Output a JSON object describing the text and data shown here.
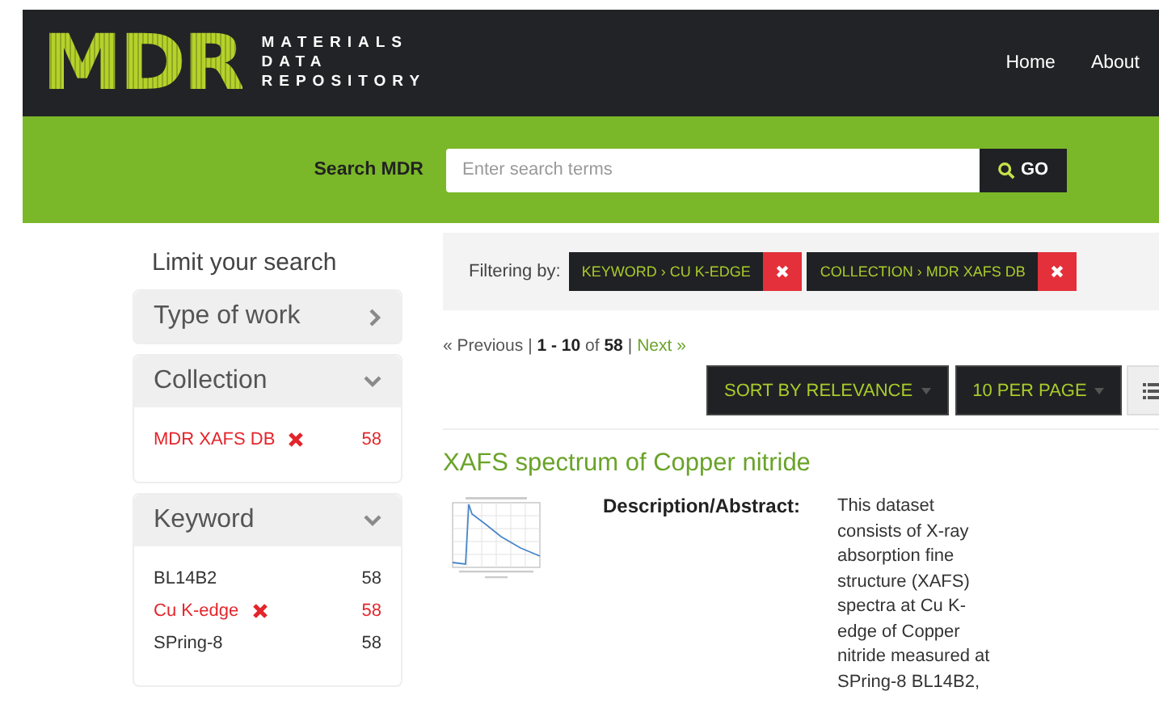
{
  "header": {
    "logo": "MDR",
    "tagline": [
      "MATERIALS",
      "DATA",
      "REPOSITORY"
    ],
    "nav": [
      "Home",
      "About"
    ]
  },
  "search": {
    "label": "Search MDR",
    "placeholder": "Enter search terms",
    "button": "GO"
  },
  "sidebar": {
    "title": "Limit your search",
    "facets": [
      {
        "title": "Type of work",
        "expanded": false
      },
      {
        "title": "Collection",
        "expanded": true,
        "items": [
          {
            "label": "MDR XAFS DB",
            "count": "58",
            "selected": true
          }
        ]
      },
      {
        "title": "Keyword",
        "expanded": true,
        "items": [
          {
            "label": "BL14B2",
            "count": "58",
            "selected": false
          },
          {
            "label": "Cu K-edge",
            "count": "58",
            "selected": true
          },
          {
            "label": "SPring-8",
            "count": "58",
            "selected": false
          }
        ]
      }
    ]
  },
  "filters": {
    "label": "Filtering by:",
    "chips": [
      "KEYWORD › CU K-EDGE",
      "COLLECTION › MDR XAFS DB"
    ]
  },
  "pagination": {
    "previous": "« Previous",
    "range": "| **1 - 10** of **58** |",
    "next": "Next »"
  },
  "sort_buttons": [
    "SORT BY RELEVANCE",
    "10 PER PAGE"
  ],
  "result": {
    "title": "XAFS spectrum of Copper nitride",
    "field_label": "Description/Abstract:",
    "description": "This dataset consists of X-ray absorption fine structure (XAFS) spectra at Cu K-edge of Copper nitride measured at SPring-8 BL14B2,"
  }
}
